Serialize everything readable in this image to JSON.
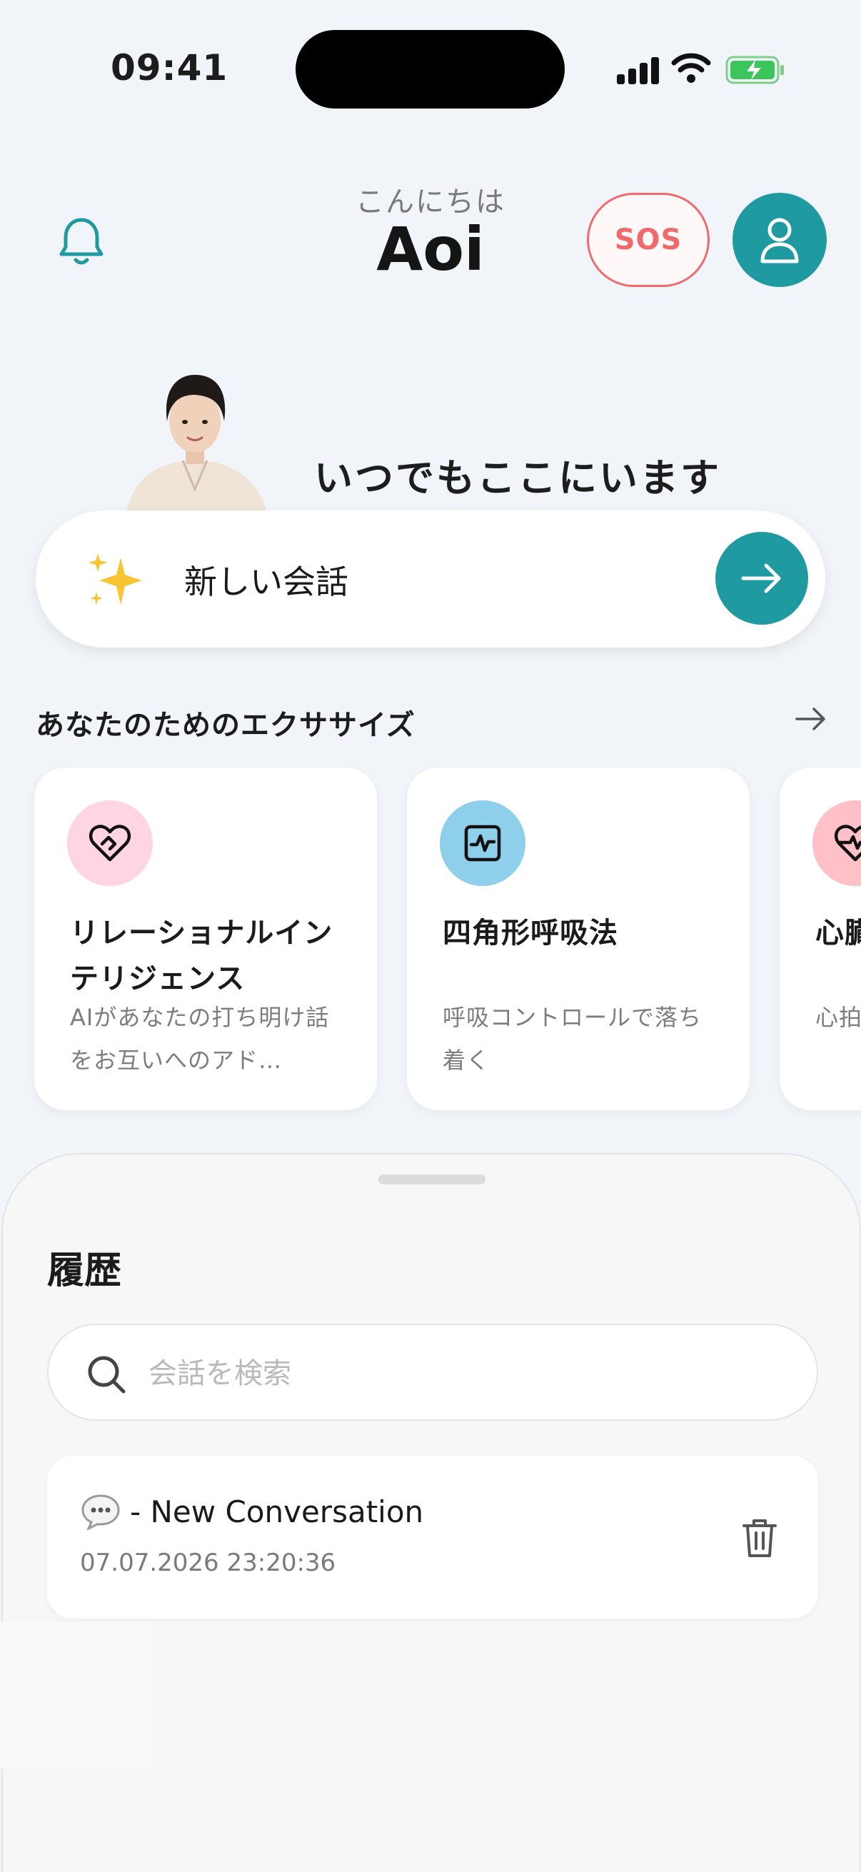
{
  "status": {
    "time": "09:41"
  },
  "header": {
    "greeting": "こんにちは",
    "name": "Aoi",
    "sos_label": "SOS"
  },
  "hero": {
    "tagline": "いつでもここにいます",
    "new_chat_label": "新しい会話"
  },
  "exercises": {
    "title": "あなたのためのエクササイズ",
    "cards": [
      {
        "title": "リレーショナルインテリジェンス",
        "desc": "AIがあなたの打ち明け話をお互いへのアド…",
        "icon": "heart-handshake-icon",
        "color": "#ffd4e3"
      },
      {
        "title": "四角形呼吸法",
        "desc": "呼吸コントロールで落ち着く",
        "icon": "pulse-square-icon",
        "color": "#8ecfeb"
      },
      {
        "title": "心臓",
        "desc": "心拍",
        "icon": "heart-pulse-icon",
        "color": "#ffc0c8"
      }
    ]
  },
  "history": {
    "title": "履歴",
    "search_placeholder": "会話を検索",
    "items": [
      {
        "title": "- New Conversation",
        "date": "07.07.2026 23:20:36"
      }
    ]
  },
  "colors": {
    "accent": "#1f9aa0",
    "sos": "#ef6b6b",
    "background": "#f1f5fa"
  }
}
